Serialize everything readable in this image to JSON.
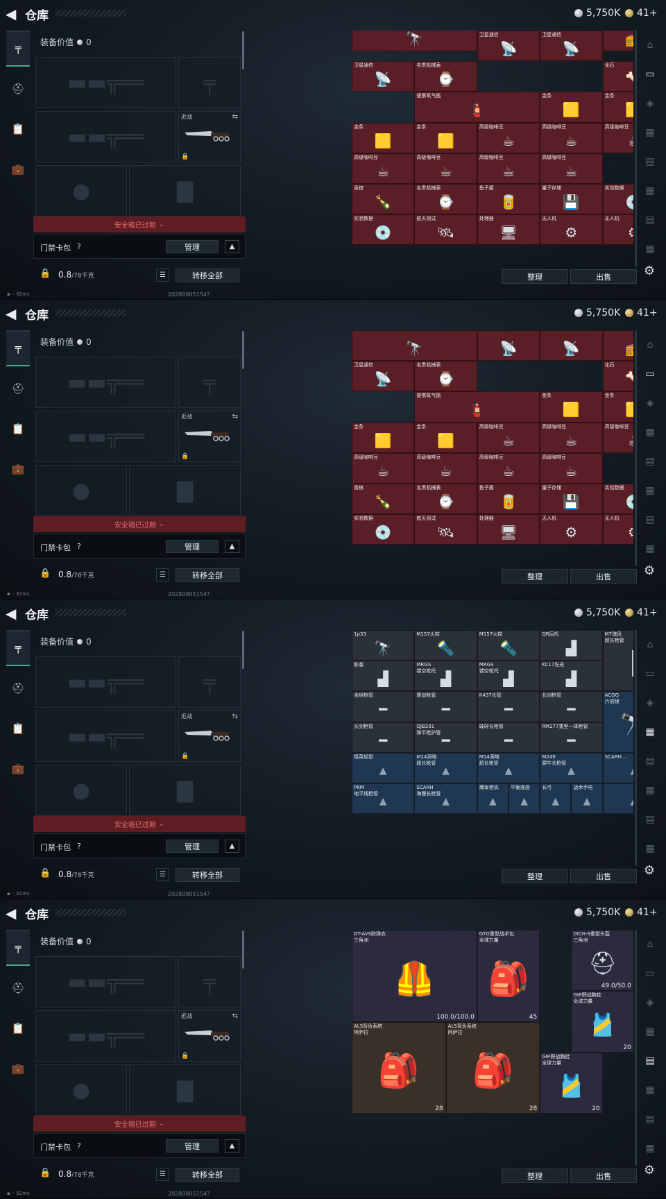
{
  "header": {
    "title": "仓库",
    "silver": "5,750K",
    "gold": "41+"
  },
  "equipment": {
    "value_label": "装备价值",
    "value": "0",
    "melee_label": "近战",
    "expired_text": "安全箱已过期",
    "keypack_label": "门禁卡包",
    "help": "?",
    "manage_label": "管理",
    "weight_value": "0.8",
    "weight_max": "/78千克",
    "transfer_all": "转移全部"
  },
  "status": {
    "ping": "82ms",
    "build": "20280805154?"
  },
  "buttons": {
    "sort": "整理",
    "sell": "出售"
  },
  "icons": {
    "back": "back-arrow-icon",
    "pistol": "pistol-icon",
    "helmet": "helmet-icon",
    "clipboard": "clipboard-icon",
    "case": "briefcase-icon",
    "lock": "lock-icon",
    "settings": "gear-icon",
    "list": "list-icon",
    "swap": "swap-icon",
    "chevron": "chevron-up-icon"
  },
  "colors": {
    "accent": "#47a88f",
    "warning": "#e26b6e",
    "item_red": "#5a1e26",
    "item_blue": "#1f3750",
    "item_gray": "#2b3138"
  },
  "frames": [
    {
      "stash_items": [
        {
          "name": "",
          "icon": "🔭",
          "c": 0,
          "r": -1,
          "w": 2,
          "h": 1,
          "bg": "red"
        },
        {
          "name": "",
          "icon": "",
          "c": 2,
          "r": -1,
          "w": 1,
          "h": 1,
          "bg": "red"
        },
        {
          "name": "",
          "icon": "📻",
          "c": 4,
          "r": -1,
          "w": 1,
          "h": 1,
          "bg": "red"
        },
        {
          "name": "卫星通信",
          "icon": "📡",
          "c": 2,
          "r": 0,
          "w": 1,
          "h": 1,
          "bg": "red"
        },
        {
          "name": "卫星通信",
          "icon": "📡",
          "c": 3,
          "r": 0,
          "w": 1,
          "h": 1,
          "bg": "red"
        },
        {
          "name": "卫星通信",
          "icon": "📡",
          "c": 0,
          "r": 1,
          "w": 1,
          "h": 1,
          "bg": "red"
        },
        {
          "name": "名贵机械表",
          "icon": "⌚",
          "c": 1,
          "r": 1,
          "w": 1,
          "h": 1,
          "bg": "red"
        },
        {
          "name": "化石",
          "icon": "🦴",
          "c": 4,
          "r": 1,
          "w": 1,
          "h": 1,
          "bg": "red"
        },
        {
          "name": "便携氧气瓶",
          "icon": "🧯",
          "c": 1,
          "r": 2,
          "w": 2,
          "h": 1,
          "bg": "red"
        },
        {
          "name": "金条",
          "icon": "🟨",
          "c": 3,
          "r": 2,
          "w": 1,
          "h": 1,
          "bg": "red"
        },
        {
          "name": "金条",
          "icon": "🟨",
          "c": 4,
          "r": 2,
          "w": 1,
          "h": 1,
          "bg": "red"
        },
        {
          "name": "金条",
          "icon": "🟨",
          "c": 0,
          "r": 3,
          "w": 1,
          "h": 1,
          "bg": "red"
        },
        {
          "name": "金条",
          "icon": "🟨",
          "c": 1,
          "r": 3,
          "w": 1,
          "h": 1,
          "bg": "red"
        },
        {
          "name": "高级咖啡豆",
          "icon": "☕",
          "c": 2,
          "r": 3,
          "w": 1,
          "h": 1,
          "bg": "red"
        },
        {
          "name": "高级咖啡豆",
          "icon": "☕",
          "c": 3,
          "r": 3,
          "w": 1,
          "h": 1,
          "bg": "red"
        },
        {
          "name": "高级咖啡豆",
          "icon": "☕",
          "c": 4,
          "r": 3,
          "w": 1,
          "h": 1,
          "bg": "red"
        },
        {
          "name": "高级咖啡豆",
          "icon": "☕",
          "c": 0,
          "r": 4,
          "w": 1,
          "h": 1,
          "bg": "red"
        },
        {
          "name": "高级咖啡豆",
          "icon": "☕",
          "c": 1,
          "r": 4,
          "w": 1,
          "h": 1,
          "bg": "red"
        },
        {
          "name": "高级咖啡豆",
          "icon": "☕",
          "c": 2,
          "r": 4,
          "w": 1,
          "h": 1,
          "bg": "red"
        },
        {
          "name": "高级咖啡豆",
          "icon": "☕",
          "c": 3,
          "r": 4,
          "w": 1,
          "h": 1,
          "bg": "red"
        },
        {
          "name": "香槟",
          "icon": "🍾",
          "c": 0,
          "r": 5,
          "w": 1,
          "h": 1,
          "bg": "red"
        },
        {
          "name": "名贵机械表",
          "icon": "⌚",
          "c": 1,
          "r": 5,
          "w": 1,
          "h": 1,
          "bg": "red"
        },
        {
          "name": "鱼子酱",
          "icon": "🥫",
          "c": 2,
          "r": 5,
          "w": 1,
          "h": 1,
          "bg": "red"
        },
        {
          "name": "量子存储",
          "icon": "💾",
          "c": 3,
          "r": 5,
          "w": 1,
          "h": 1,
          "bg": "red"
        },
        {
          "name": "实验数据",
          "icon": "💿",
          "c": 4,
          "r": 5,
          "w": 1,
          "h": 1,
          "bg": "red"
        },
        {
          "name": "实验数据",
          "icon": "💿",
          "c": 0,
          "r": 6,
          "w": 1,
          "h": 1,
          "bg": "red"
        },
        {
          "name": "航天测试",
          "icon": "🛰",
          "c": 1,
          "r": 6,
          "w": 1,
          "h": 1,
          "bg": "red"
        },
        {
          "name": "处理器",
          "icon": "🖥",
          "c": 2,
          "r": 6,
          "w": 1,
          "h": 1,
          "bg": "red"
        },
        {
          "name": "无人机",
          "icon": "⚙",
          "c": 3,
          "r": 6,
          "w": 1,
          "h": 1,
          "bg": "red"
        },
        {
          "name": "无人机",
          "icon": "⚙",
          "c": 4,
          "r": 6,
          "w": 1,
          "h": 1,
          "bg": "red"
        }
      ]
    },
    {
      "stash_items": [
        {
          "name": "",
          "icon": "🔭",
          "c": 0,
          "r": 0,
          "w": 2,
          "h": 1,
          "bg": "red"
        },
        {
          "name": "",
          "icon": "📡",
          "c": 2,
          "r": 0,
          "w": 1,
          "h": 1,
          "bg": "red"
        },
        {
          "name": "",
          "icon": "📡",
          "c": 3,
          "r": 0,
          "w": 1,
          "h": 1,
          "bg": "red"
        },
        {
          "name": "",
          "icon": "📻",
          "c": 4,
          "r": 0,
          "w": 1,
          "h": 1,
          "bg": "red"
        },
        {
          "name": "卫星通信",
          "icon": "📡",
          "c": 0,
          "r": 1,
          "w": 1,
          "h": 1,
          "bg": "red"
        },
        {
          "name": "名贵机械表",
          "icon": "⌚",
          "c": 1,
          "r": 1,
          "w": 1,
          "h": 1,
          "bg": "red"
        },
        {
          "name": "化石",
          "icon": "🦴",
          "c": 4,
          "r": 1,
          "w": 1,
          "h": 1,
          "bg": "red"
        },
        {
          "name": "便携氧气瓶",
          "icon": "🧯",
          "c": 1,
          "r": 2,
          "w": 2,
          "h": 1,
          "bg": "red"
        },
        {
          "name": "金条",
          "icon": "🟨",
          "c": 3,
          "r": 2,
          "w": 1,
          "h": 1,
          "bg": "red"
        },
        {
          "name": "金条",
          "icon": "🟨",
          "c": 4,
          "r": 2,
          "w": 1,
          "h": 1,
          "bg": "red"
        },
        {
          "name": "金条",
          "icon": "🟨",
          "c": 0,
          "r": 3,
          "w": 1,
          "h": 1,
          "bg": "red"
        },
        {
          "name": "金条",
          "icon": "🟨",
          "c": 1,
          "r": 3,
          "w": 1,
          "h": 1,
          "bg": "red"
        },
        {
          "name": "高级咖啡豆",
          "icon": "☕",
          "c": 2,
          "r": 3,
          "w": 1,
          "h": 1,
          "bg": "red"
        },
        {
          "name": "高级咖啡豆",
          "icon": "☕",
          "c": 3,
          "r": 3,
          "w": 1,
          "h": 1,
          "bg": "red"
        },
        {
          "name": "高级咖啡豆",
          "icon": "☕",
          "c": 4,
          "r": 3,
          "w": 1,
          "h": 1,
          "bg": "red"
        },
        {
          "name": "高级咖啡豆",
          "icon": "☕",
          "c": 0,
          "r": 4,
          "w": 1,
          "h": 1,
          "bg": "red"
        },
        {
          "name": "高级咖啡豆",
          "icon": "☕",
          "c": 1,
          "r": 4,
          "w": 1,
          "h": 1,
          "bg": "red"
        },
        {
          "name": "高级咖啡豆",
          "icon": "☕",
          "c": 2,
          "r": 4,
          "w": 1,
          "h": 1,
          "bg": "red"
        },
        {
          "name": "高级咖啡豆",
          "icon": "☕",
          "c": 3,
          "r": 4,
          "w": 1,
          "h": 1,
          "bg": "red"
        },
        {
          "name": "香槟",
          "icon": "🍾",
          "c": 0,
          "r": 5,
          "w": 1,
          "h": 1,
          "bg": "red"
        },
        {
          "name": "名贵机械表",
          "icon": "⌚",
          "c": 1,
          "r": 5,
          "w": 1,
          "h": 1,
          "bg": "red"
        },
        {
          "name": "鱼子酱",
          "icon": "🥫",
          "c": 2,
          "r": 5,
          "w": 1,
          "h": 1,
          "bg": "red"
        },
        {
          "name": "量子存储",
          "icon": "💾",
          "c": 3,
          "r": 5,
          "w": 1,
          "h": 1,
          "bg": "red"
        },
        {
          "name": "实验数据",
          "icon": "💿",
          "c": 4,
          "r": 5,
          "w": 1,
          "h": 1,
          "bg": "red"
        },
        {
          "name": "实验数据",
          "icon": "💿",
          "c": 0,
          "r": 6,
          "w": 1,
          "h": 1,
          "bg": "red"
        },
        {
          "name": "航天测试",
          "icon": "🛰",
          "c": 1,
          "r": 6,
          "w": 1,
          "h": 1,
          "bg": "red"
        },
        {
          "name": "处理器",
          "icon": "🖥",
          "c": 2,
          "r": 6,
          "w": 1,
          "h": 1,
          "bg": "red"
        },
        {
          "name": "无人机",
          "icon": "⚙",
          "c": 3,
          "r": 6,
          "w": 1,
          "h": 1,
          "bg": "red"
        },
        {
          "name": "无人机",
          "icon": "⚙",
          "c": 4,
          "r": 6,
          "w": 1,
          "h": 1,
          "bg": "red"
        }
      ]
    },
    {
      "stash_items": [
        {
          "name": "1p33",
          "icon": "🔭",
          "c": 0,
          "r": 0,
          "w": 1,
          "h": 1,
          "bg": "gray"
        },
        {
          "name": "M157火控",
          "icon": "🔦",
          "c": 1,
          "r": 0,
          "w": 1,
          "h": 1,
          "bg": "gray"
        },
        {
          "name": "M157火控",
          "icon": "🔦",
          "c": 2,
          "r": 0,
          "w": 1,
          "h": 1,
          "bg": "gray"
        },
        {
          "name": "QR后托",
          "icon": "▟",
          "c": 3,
          "r": 0,
          "w": 1,
          "h": 1,
          "bg": "gray"
        },
        {
          "name": "M7瑰风\n超长枪管",
          "icon": "┃",
          "c": 4,
          "r": 0,
          "w": 1,
          "h": 2,
          "bg": "gray"
        },
        {
          "name": "影袭",
          "icon": "▟",
          "c": 0,
          "r": 1,
          "w": 1,
          "h": 1,
          "bg": "gray"
        },
        {
          "name": "MRGS\n镂空枪托",
          "icon": "▟",
          "c": 1,
          "r": 1,
          "w": 1,
          "h": 1,
          "bg": "gray"
        },
        {
          "name": "MRGS\n镂空枪托",
          "icon": "▟",
          "c": 2,
          "r": 1,
          "w": 1,
          "h": 1,
          "bg": "gray"
        },
        {
          "name": "KC17先进",
          "icon": "▟",
          "c": 3,
          "r": 1,
          "w": 1,
          "h": 1,
          "bg": "gray"
        },
        {
          "name": "余烬枪管",
          "icon": "━",
          "c": 0,
          "r": 2,
          "w": 1,
          "h": 1,
          "bg": "gray"
        },
        {
          "name": "摩战枪管",
          "icon": "━",
          "c": 1,
          "r": 2,
          "w": 1,
          "h": 1,
          "bg": "gray"
        },
        {
          "name": "K437长管",
          "icon": "━",
          "c": 2,
          "r": 2,
          "w": 1,
          "h": 1,
          "bg": "gray"
        },
        {
          "name": "长剑枪管",
          "icon": "━",
          "c": 3,
          "r": 2,
          "w": 1,
          "h": 1,
          "bg": "gray"
        },
        {
          "name": "ACOG\n六倍镜",
          "icon": "🔭",
          "c": 4,
          "r": 2,
          "w": 1,
          "h": 2,
          "bg": "blue"
        },
        {
          "name": "长剑枪管",
          "icon": "━",
          "c": 0,
          "r": 3,
          "w": 1,
          "h": 1,
          "bg": "gray"
        },
        {
          "name": "QJB201\n弹平枪护管",
          "icon": "━",
          "c": 1,
          "r": 3,
          "w": 1,
          "h": 1,
          "bg": "gray"
        },
        {
          "name": "破碎长枪管",
          "icon": "━",
          "c": 2,
          "r": 3,
          "w": 1,
          "h": 1,
          "bg": "gray"
        },
        {
          "name": "RM277重型一体枪管",
          "icon": "━",
          "c": 3,
          "r": 3,
          "w": 1,
          "h": 1,
          "bg": "gray"
        },
        {
          "name": "精英轻型",
          "icon": "▲",
          "c": 0,
          "r": 4,
          "w": 1,
          "h": 1,
          "bg": "blue"
        },
        {
          "name": "M14洞嗡\n超长枪管",
          "icon": "▲",
          "c": 1,
          "r": 4,
          "w": 1,
          "h": 1,
          "bg": "blue"
        },
        {
          "name": "M14洞嗡\n超长枪管",
          "icon": "▲",
          "c": 2,
          "r": 4,
          "w": 1,
          "h": 1,
          "bg": "blue"
        },
        {
          "name": "M249\n犀牛长枪管",
          "icon": "▲",
          "c": 3,
          "r": 4,
          "w": 1,
          "h": 1,
          "bg": "blue"
        },
        {
          "name": "SCARH ...",
          "icon": "▲",
          "c": 4,
          "r": 4,
          "w": 1,
          "h": 1,
          "bg": "blue"
        },
        {
          "name": "PKM\n地平线枪管",
          "icon": "▲",
          "c": 0,
          "r": 5,
          "w": 1,
          "h": 1,
          "bg": "blue"
        },
        {
          "name": "SCARH\n海狸长枪管",
          "icon": "▲",
          "c": 1,
          "r": 5,
          "w": 1,
          "h": 1,
          "bg": "blue"
        },
        {
          "name": "爆发枪机",
          "icon": "▲",
          "c": 2,
          "r": 5,
          "w": 0.5,
          "h": 1,
          "bg": "blue"
        },
        {
          "name": "平衡底座",
          "icon": "▲",
          "c": 2.5,
          "r": 5,
          "w": 0.5,
          "h": 1,
          "bg": "blue"
        },
        {
          "name": "长弓",
          "icon": "▲",
          "c": 3,
          "r": 5,
          "w": 0.5,
          "h": 1,
          "bg": "blue"
        },
        {
          "name": "战术手电",
          "icon": "▲",
          "c": 3.5,
          "r": 5,
          "w": 0.5,
          "h": 1,
          "bg": "blue"
        },
        {
          "name": "",
          "icon": "▲",
          "c": 4,
          "r": 5,
          "w": 1,
          "h": 1,
          "bg": "blue"
        }
      ]
    },
    {
      "stash_items": [
        {
          "name": "DT-AVS防弹衣\n三角洲",
          "icon": "🦺",
          "c": 0,
          "r": 0,
          "w": 2,
          "h": 3,
          "bg": "purple",
          "count": "100.0/100.0"
        },
        {
          "name": "GTO重型战术包\n全球力量",
          "icon": "🎒",
          "c": 2,
          "r": 0,
          "w": 1,
          "h": 3,
          "bg": "purple",
          "count": "45"
        },
        {
          "name": "DICH-9重型头盔\n三角洲",
          "icon": "⛑",
          "c": 3.5,
          "r": 0,
          "w": 1,
          "h": 2,
          "bg": "purple",
          "count": "49.0/50.0"
        },
        {
          "name": "GIR野战胸挂\n全球力量",
          "icon": "🎽",
          "c": 3.5,
          "r": 2,
          "w": 1,
          "h": 2,
          "bg": "purple",
          "count": "20"
        },
        {
          "name": "ALS背负系统\n阿萨拉",
          "icon": "🎒",
          "c": 0,
          "r": 3,
          "w": 1.5,
          "h": 3,
          "bg": "brown",
          "count": "28"
        },
        {
          "name": "ALS背负系统\n阿萨拉",
          "icon": "🎒",
          "c": 1.5,
          "r": 3,
          "w": 1.5,
          "h": 3,
          "bg": "brown",
          "count": "28"
        },
        {
          "name": "GIR野战胸挂\n全球力量",
          "icon": "🎽",
          "c": 3,
          "r": 4,
          "w": 1,
          "h": 2,
          "bg": "purple",
          "count": "20"
        }
      ]
    }
  ]
}
